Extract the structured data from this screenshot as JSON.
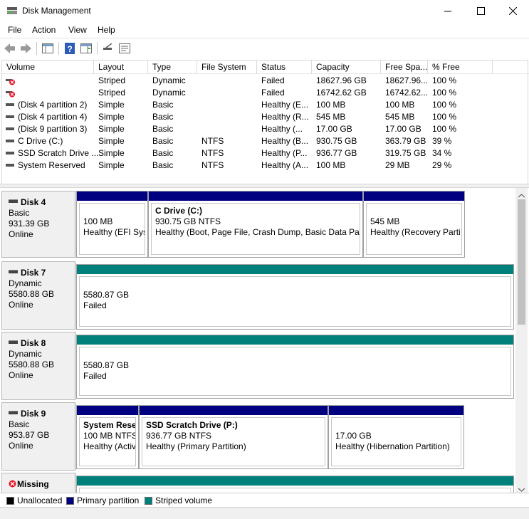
{
  "window": {
    "title": "Disk Management"
  },
  "menu": [
    "File",
    "Action",
    "View",
    "Help"
  ],
  "volume_list": {
    "columns": [
      "Volume",
      "Layout",
      "Type",
      "File System",
      "Status",
      "Capacity",
      "Free Spa...",
      "% Free"
    ],
    "rows": [
      {
        "icon": "failed-disk-icon",
        "volume": "",
        "layout": "Striped",
        "type": "Dynamic",
        "fs": "",
        "status": "Failed",
        "capacity": "18627.96 GB",
        "free": "18627.96...",
        "pct": "100 %"
      },
      {
        "icon": "failed-disk-icon",
        "volume": "",
        "layout": "Striped",
        "type": "Dynamic",
        "fs": "",
        "status": "Failed",
        "capacity": "16742.62 GB",
        "free": "16742.62...",
        "pct": "100 %"
      },
      {
        "icon": "volume-icon",
        "volume": "(Disk 4 partition 2)",
        "layout": "Simple",
        "type": "Basic",
        "fs": "",
        "status": "Healthy (E...",
        "capacity": "100 MB",
        "free": "100 MB",
        "pct": "100 %"
      },
      {
        "icon": "volume-icon",
        "volume": "(Disk 4 partition 4)",
        "layout": "Simple",
        "type": "Basic",
        "fs": "",
        "status": "Healthy (R...",
        "capacity": "545 MB",
        "free": "545 MB",
        "pct": "100 %"
      },
      {
        "icon": "volume-icon",
        "volume": "(Disk 9 partition 3)",
        "layout": "Simple",
        "type": "Basic",
        "fs": "",
        "status": "Healthy (...",
        "capacity": "17.00 GB",
        "free": "17.00 GB",
        "pct": "100 %"
      },
      {
        "icon": "volume-icon",
        "volume": "C Drive (C:)",
        "layout": "Simple",
        "type": "Basic",
        "fs": "NTFS",
        "status": "Healthy (B...",
        "capacity": "930.75 GB",
        "free": "363.79 GB",
        "pct": "39 %"
      },
      {
        "icon": "volume-icon",
        "volume": "SSD Scratch Drive ...",
        "layout": "Simple",
        "type": "Basic",
        "fs": "NTFS",
        "status": "Healthy (P...",
        "capacity": "936.77 GB",
        "free": "319.75 GB",
        "pct": "34 %"
      },
      {
        "icon": "volume-icon",
        "volume": "System Reserved",
        "layout": "Simple",
        "type": "Basic",
        "fs": "NTFS",
        "status": "Healthy (A...",
        "capacity": "100 MB",
        "free": "29 MB",
        "pct": "29 %"
      }
    ]
  },
  "disks": [
    {
      "name": "Disk 4",
      "type": "Basic",
      "size": "931.39 GB",
      "state": "Online",
      "partitions": [
        {
          "title": "",
          "line1": "100 MB",
          "line2": "Healthy (EFI Syst"
        },
        {
          "title": "C Drive  (C:)",
          "line1": "930.75 GB NTFS",
          "line2": "Healthy (Boot, Page File, Crash Dump, Basic Data Partit"
        },
        {
          "title": "",
          "line1": "545 MB",
          "line2": "Healthy (Recovery Parti"
        }
      ]
    },
    {
      "name": "Disk 7",
      "type": "Dynamic",
      "size": "5580.88 GB",
      "state": "Online",
      "partitions": [
        {
          "title": "",
          "line1": "5580.87 GB",
          "line2": "Failed"
        }
      ]
    },
    {
      "name": "Disk 8",
      "type": "Dynamic",
      "size": "5580.88 GB",
      "state": "Online",
      "partitions": [
        {
          "title": "",
          "line1": "5580.87 GB",
          "line2": "Failed"
        }
      ]
    },
    {
      "name": "Disk 9",
      "type": "Basic",
      "size": "953.87 GB",
      "state": "Online",
      "partitions": [
        {
          "title": "System Reser",
          "line1": "100 MB NTFS",
          "line2": "Healthy (Activ"
        },
        {
          "title": "SSD Scratch Drive  (P:)",
          "line1": "936.77 GB NTFS",
          "line2": "Healthy (Primary Partition)"
        },
        {
          "title": "",
          "line1": "17.00 GB",
          "line2": "Healthy (Hibernation Partition)"
        }
      ]
    },
    {
      "name": "Missing",
      "type": "",
      "size": "",
      "state": ""
    }
  ],
  "legend": [
    {
      "label": "Unallocated",
      "color": "#000000"
    },
    {
      "label": "Primary partition",
      "color": "#000080"
    },
    {
      "label": "Striped volume",
      "color": "#008080"
    }
  ],
  "colors": {
    "primary": "#000080",
    "striped": "#00807a",
    "failed": "#e81123"
  }
}
